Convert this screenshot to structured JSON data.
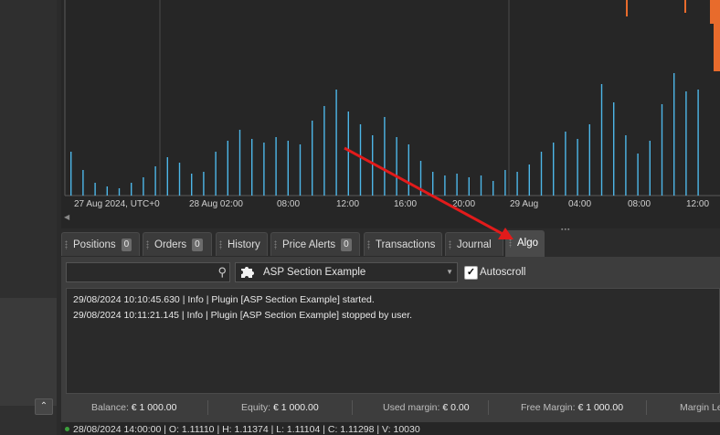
{
  "chart": {
    "bar_color": "#4db6e8",
    "candle_color": "#e86b2c",
    "time_labels": [
      "27 Aug 2024, UTC+0",
      "28 Aug 02:00",
      "08:00",
      "12:00",
      "16:00",
      "20:00",
      "29 Aug",
      "04:00",
      "08:00",
      "12:00"
    ]
  },
  "tabs": [
    {
      "label": "Positions",
      "badge": "0"
    },
    {
      "label": "Orders",
      "badge": "0"
    },
    {
      "label": "History"
    },
    {
      "label": "Price Alerts",
      "badge": "0"
    },
    {
      "label": "Transactions"
    },
    {
      "label": "Journal"
    },
    {
      "label": "Algo",
      "active": true
    }
  ],
  "toolbar": {
    "search_placeholder": "",
    "search_icon": "search-icon",
    "plugin_icon": "puzzle-icon",
    "plugin_selected": "ASP Section Example",
    "autoscroll_label": "Autoscroll",
    "autoscroll_checked": true
  },
  "log": [
    "29/08/2024 10:10:45.630 | Info | Plugin [ASP Section Example] started.",
    "29/08/2024 10:11:21.145 | Info | Plugin [ASP Section Example] stopped by user."
  ],
  "status": {
    "balance_label": "Balance:",
    "balance_value": "€ 1 000.00",
    "equity_label": "Equity:",
    "equity_value": "€ 1 000.00",
    "used_margin_label": "Used margin:",
    "used_margin_value": "€ 0.00",
    "free_margin_label": "Free Margin:",
    "free_margin_value": "€ 1 000.00",
    "margin_level_label": "Margin Le"
  },
  "footer": {
    "ohlc": "28/08/2024 14:00:00 |  O: 1.11110 |  H: 1.11374 |  L: 1.11104 |  C: 1.11298 |  V: 10030"
  },
  "annotation": {
    "arrow_color": "#e21b1b"
  }
}
